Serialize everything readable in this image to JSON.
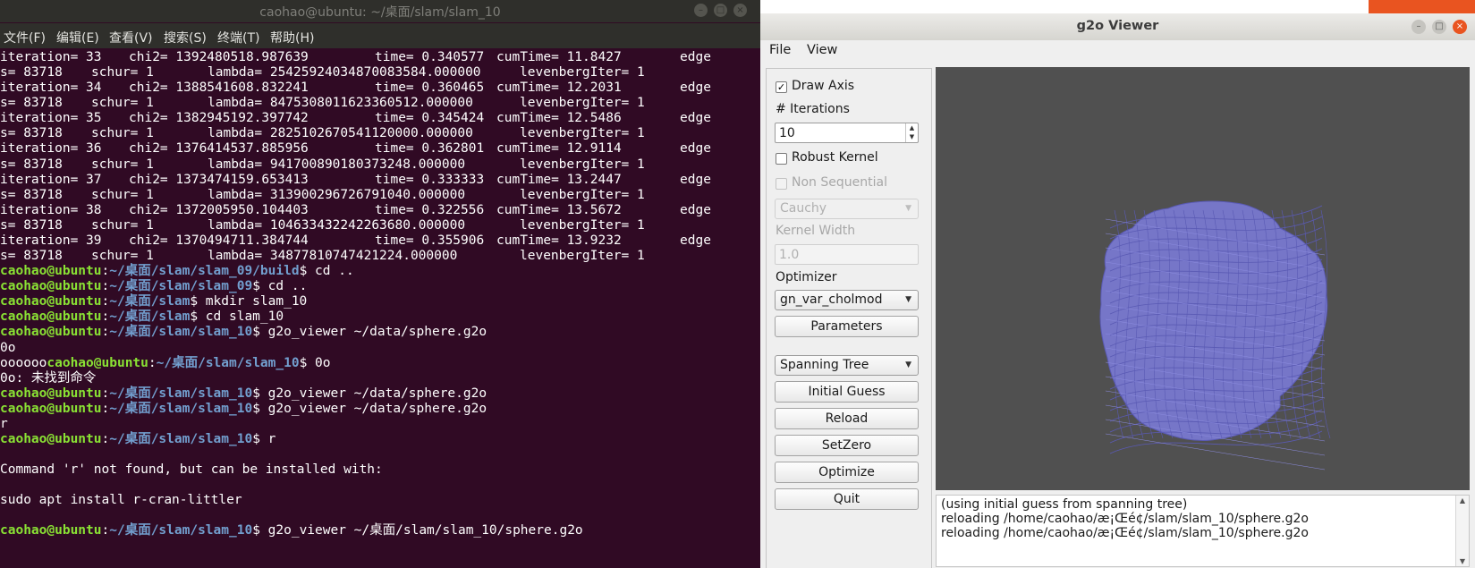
{
  "terminal": {
    "title": "caohao@ubuntu: ~/桌面/slam/slam_10",
    "menu": [
      "文件(F)",
      "编辑(E)",
      "查看(V)",
      "搜索(S)",
      "终端(T)",
      "帮助(H)"
    ],
    "lines": [
      {
        "type": "cols",
        "cols": [
          "iteration= 33",
          "chi2= 1392480518.987639",
          "time= 0.340577",
          "cumTime= 11.8427",
          "edge"
        ]
      },
      {
        "type": "cols",
        "cols": [
          "s= 83718",
          "schur= 1",
          "lambda= 2542592403487008358​4.000000",
          "levenbergIter= 1"
        ]
      },
      {
        "type": "cols",
        "cols": [
          "iteration= 34",
          "chi2= 1388541608.832241",
          "time= 0.360465",
          "cumTime= 12.2031",
          "edge"
        ]
      },
      {
        "type": "cols",
        "cols": [
          "s= 83718",
          "schur= 1",
          "lambda= 8475308011623360512.000000",
          "levenbergIter= 1"
        ]
      },
      {
        "type": "cols",
        "cols": [
          "iteration= 35",
          "chi2= 1382945192.397742",
          "time= 0.345424",
          "cumTime= 12.5486",
          "edge"
        ]
      },
      {
        "type": "cols",
        "cols": [
          "s= 83718",
          "schur= 1",
          "lambda= 2825102670541120000.000000",
          "levenbergIter= 1"
        ]
      },
      {
        "type": "cols",
        "cols": [
          "iteration= 36",
          "chi2= 1376414537.885956",
          "time= 0.362801",
          "cumTime= 12.9114",
          "edge"
        ]
      },
      {
        "type": "cols",
        "cols": [
          "s= 83718",
          "schur= 1",
          "lambda= 941700890180373248.000000",
          "levenbergIter= 1"
        ]
      },
      {
        "type": "cols",
        "cols": [
          "iteration= 37",
          "chi2= 1373474159.653413",
          "time= 0.333333",
          "cumTime= 13.2447",
          "edge"
        ]
      },
      {
        "type": "cols",
        "cols": [
          "s= 83718",
          "schur= 1",
          "lambda= 313900296726791040.000000",
          "levenbergIter= 1"
        ]
      },
      {
        "type": "cols",
        "cols": [
          "iteration= 38",
          "chi2= 1372005950.104403",
          "time= 0.322556",
          "cumTime= 13.5672",
          "edge"
        ]
      },
      {
        "type": "cols",
        "cols": [
          "s= 83718",
          "schur= 1",
          "lambda= 104633432242263680.000000",
          "levenbergIter= 1"
        ]
      },
      {
        "type": "cols",
        "cols": [
          "iteration= 39",
          "chi2= 1370494711.384744",
          "time= 0.355906",
          "cumTime= 13.9232",
          "edge"
        ]
      },
      {
        "type": "cols",
        "cols": [
          "s= 83718",
          "schur= 1",
          "lambda= 34877810747421224.000000",
          "levenbergIter= 1"
        ]
      },
      {
        "type": "prompt",
        "pre": "",
        "user": "caohao@ubuntu",
        "path": "~/桌面/slam/slam_09/build",
        "cmd": "$ cd .."
      },
      {
        "type": "prompt",
        "pre": "",
        "user": "caohao@ubuntu",
        "path": "~/桌面/slam/slam_09",
        "cmd": "$ cd .."
      },
      {
        "type": "prompt",
        "pre": "",
        "user": "caohao@ubuntu",
        "path": "~/桌面/slam",
        "cmd": "$ mkdir slam_10"
      },
      {
        "type": "prompt",
        "pre": "",
        "user": "caohao@ubuntu",
        "path": "~/桌面/slam",
        "cmd": "$ cd slam_10"
      },
      {
        "type": "prompt",
        "pre": "",
        "user": "caohao@ubuntu",
        "path": "~/桌面/slam/slam_10",
        "cmd": "$ g2o_viewer ~/data/sphere.g2o"
      },
      {
        "type": "text",
        "text": "0o"
      },
      {
        "type": "prompt",
        "pre": "oooooo",
        "user": "caohao@ubuntu",
        "path": "~/桌面/slam/slam_10",
        "cmd": "$ 0o"
      },
      {
        "type": "text",
        "text": "0o: 未找到命令"
      },
      {
        "type": "prompt",
        "pre": "",
        "user": "caohao@ubuntu",
        "path": "~/桌面/slam/slam_10",
        "cmd": "$ g2o_viewer ~/data/sphere.g2o"
      },
      {
        "type": "prompt",
        "pre": "",
        "user": "caohao@ubuntu",
        "path": "~/桌面/slam/slam_10",
        "cmd": "$ g2o_viewer ~/data/sphere.g2o"
      },
      {
        "type": "text",
        "text": "r"
      },
      {
        "type": "prompt",
        "pre": "",
        "user": "caohao@ubuntu",
        "path": "~/桌面/slam/slam_10",
        "cmd": "$ r"
      },
      {
        "type": "text",
        "text": ""
      },
      {
        "type": "text",
        "text": "Command 'r' not found, but can be installed with:"
      },
      {
        "type": "text",
        "text": ""
      },
      {
        "type": "text",
        "text": "sudo apt install r-cran-littler"
      },
      {
        "type": "text",
        "text": ""
      },
      {
        "type": "prompt",
        "pre": "",
        "user": "caohao@ubuntu",
        "path": "~/桌面/slam/slam_10",
        "cmd": "$ g2o_viewer ~/桌面/slam/slam_10/sphere.g2o"
      }
    ]
  },
  "viewer": {
    "title": "g2o Viewer",
    "menu": [
      "File",
      "View"
    ],
    "panel": {
      "draw_axis_label": "Draw Axis",
      "draw_axis_checked": true,
      "iterations_label": "# Iterations",
      "iterations_value": "10",
      "robust_kernel_label": "Robust Kernel",
      "robust_kernel_checked": false,
      "non_sequential_label": "Non Sequential",
      "kernel_select": "Cauchy",
      "kernel_width_label": "Kernel Width",
      "kernel_width_value": "1.0",
      "optimizer_label": "Optimizer",
      "optimizer_select": "gn_var_cholmod",
      "parameters_button": "Parameters",
      "init_select": "Spanning Tree",
      "initial_guess_button": "Initial Guess",
      "reload_button": "Reload",
      "setzero_button": "SetZero",
      "optimize_button": "Optimize",
      "quit_button": "Quit"
    },
    "log": [
      "(using initial guess from spanning tree)",
      "reloading /home/caohao/æ¡Œé¢/slam/slam_10/sphere.g2o",
      "reloading /home/caohao/æ¡Œé¢/slam/slam_10/sphere.g2o"
    ],
    "colors": {
      "canvas_bg": "#505050",
      "mesh": "#7b7bd0",
      "mesh_dark": "#5a5ab4"
    }
  }
}
